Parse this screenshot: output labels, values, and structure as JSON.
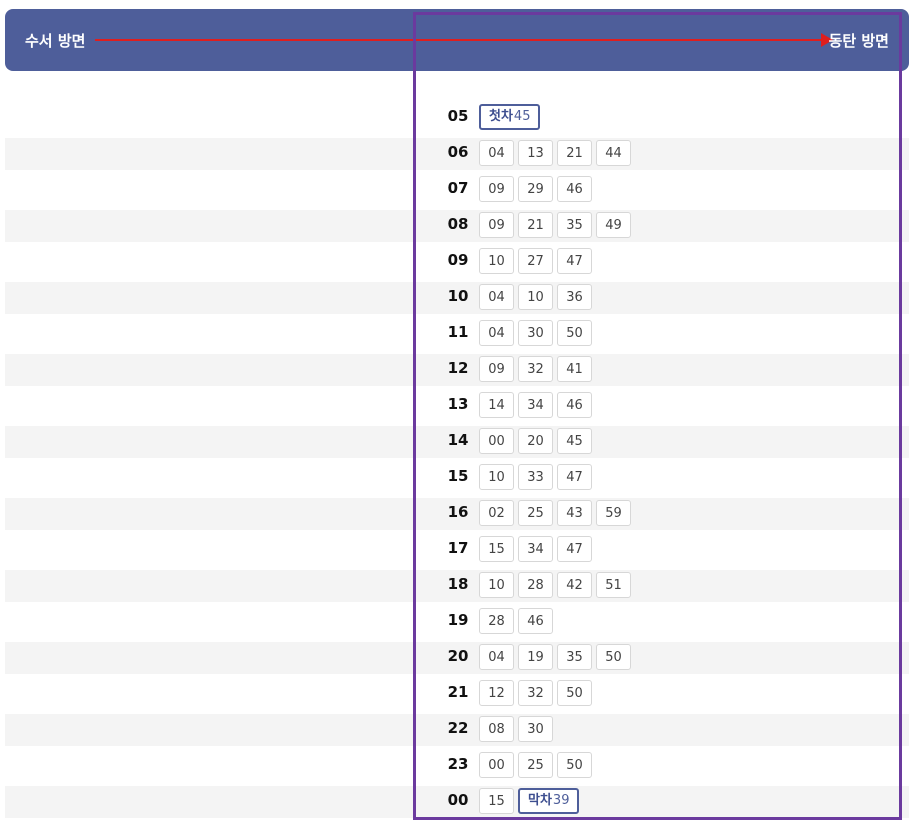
{
  "direction": {
    "from": "수서 방면",
    "to": "동탄 방면",
    "accent_color": "#e01e1e"
  },
  "header_color": "#4e5e9a",
  "schedule": [
    {
      "hour": "05",
      "minutes": [
        {
          "min": "45",
          "label": "첫차"
        }
      ]
    },
    {
      "hour": "06",
      "minutes": [
        {
          "min": "04"
        },
        {
          "min": "13"
        },
        {
          "min": "21"
        },
        {
          "min": "44"
        }
      ]
    },
    {
      "hour": "07",
      "minutes": [
        {
          "min": "09"
        },
        {
          "min": "29"
        },
        {
          "min": "46"
        }
      ]
    },
    {
      "hour": "08",
      "minutes": [
        {
          "min": "09"
        },
        {
          "min": "21"
        },
        {
          "min": "35"
        },
        {
          "min": "49"
        }
      ]
    },
    {
      "hour": "09",
      "minutes": [
        {
          "min": "10"
        },
        {
          "min": "27"
        },
        {
          "min": "47"
        }
      ]
    },
    {
      "hour": "10",
      "minutes": [
        {
          "min": "04"
        },
        {
          "min": "10"
        },
        {
          "min": "36"
        }
      ]
    },
    {
      "hour": "11",
      "minutes": [
        {
          "min": "04"
        },
        {
          "min": "30"
        },
        {
          "min": "50"
        }
      ]
    },
    {
      "hour": "12",
      "minutes": [
        {
          "min": "09"
        },
        {
          "min": "32"
        },
        {
          "min": "41"
        }
      ]
    },
    {
      "hour": "13",
      "minutes": [
        {
          "min": "14"
        },
        {
          "min": "34"
        },
        {
          "min": "46"
        }
      ]
    },
    {
      "hour": "14",
      "minutes": [
        {
          "min": "00"
        },
        {
          "min": "20"
        },
        {
          "min": "45"
        }
      ]
    },
    {
      "hour": "15",
      "minutes": [
        {
          "min": "10"
        },
        {
          "min": "33"
        },
        {
          "min": "47"
        }
      ]
    },
    {
      "hour": "16",
      "minutes": [
        {
          "min": "02"
        },
        {
          "min": "25"
        },
        {
          "min": "43"
        },
        {
          "min": "59"
        }
      ]
    },
    {
      "hour": "17",
      "minutes": [
        {
          "min": "15"
        },
        {
          "min": "34"
        },
        {
          "min": "47"
        }
      ]
    },
    {
      "hour": "18",
      "minutes": [
        {
          "min": "10"
        },
        {
          "min": "28"
        },
        {
          "min": "42"
        },
        {
          "min": "51"
        }
      ]
    },
    {
      "hour": "19",
      "minutes": [
        {
          "min": "28"
        },
        {
          "min": "46"
        }
      ]
    },
    {
      "hour": "20",
      "minutes": [
        {
          "min": "04"
        },
        {
          "min": "19"
        },
        {
          "min": "35"
        },
        {
          "min": "50"
        }
      ]
    },
    {
      "hour": "21",
      "minutes": [
        {
          "min": "12"
        },
        {
          "min": "32"
        },
        {
          "min": "50"
        }
      ]
    },
    {
      "hour": "22",
      "minutes": [
        {
          "min": "08"
        },
        {
          "min": "30"
        }
      ]
    },
    {
      "hour": "23",
      "minutes": [
        {
          "min": "00"
        },
        {
          "min": "25"
        },
        {
          "min": "50"
        }
      ]
    },
    {
      "hour": "00",
      "minutes": [
        {
          "min": "15"
        },
        {
          "min": "39",
          "label": "막차"
        }
      ]
    }
  ]
}
